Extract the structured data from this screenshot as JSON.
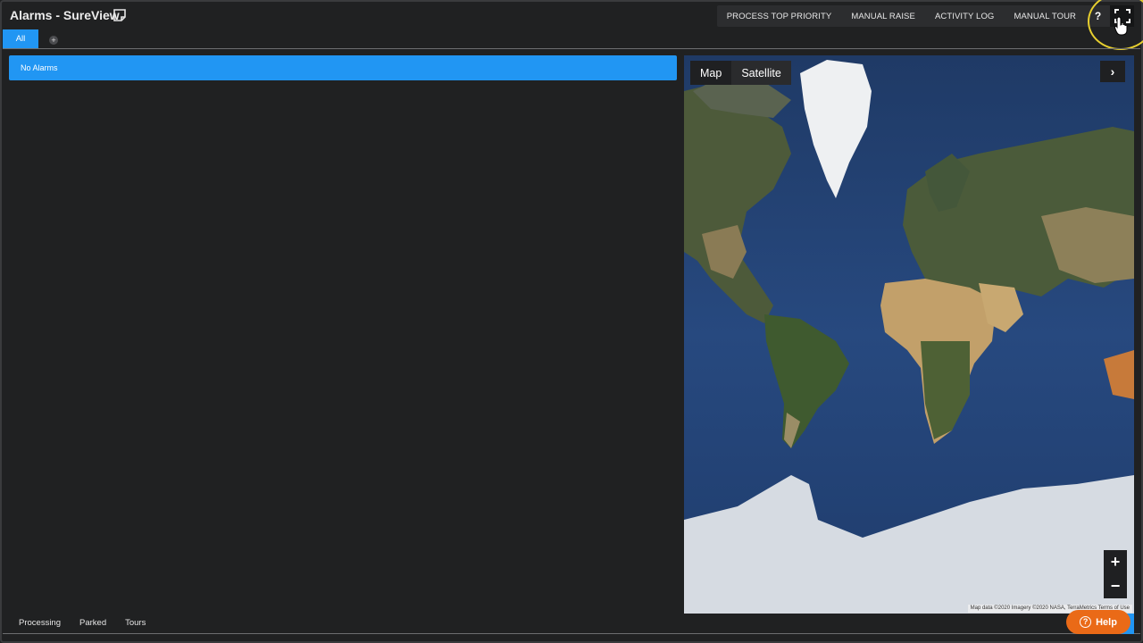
{
  "app": {
    "title": "Alarms - SureView"
  },
  "toolbar": {
    "buttons": [
      "PROCESS TOP PRIORITY",
      "MANUAL RAISE",
      "ACTIVITY LOG",
      "MANUAL TOUR"
    ],
    "help_glyph": "?",
    "fullscreen_icon": "fullscreen-icon"
  },
  "tabs": {
    "all_label": "All",
    "add_glyph": "+"
  },
  "alarms": {
    "empty_text": "No Alarms"
  },
  "map": {
    "type_buttons": [
      "Map",
      "Satellite"
    ],
    "expand_glyph": "›",
    "zoom_in": "+",
    "zoom_out": "−",
    "attribution": "Map data ©2020 Imagery ©2020 NASA, TerraMetrics  Terms of Use"
  },
  "bottom_tabs": [
    "Processing",
    "Parked",
    "Tours"
  ],
  "help_button": {
    "label": "Help",
    "glyph": "?"
  },
  "colors": {
    "accent": "#2196f3",
    "help": "#ea6a17",
    "background": "#202122",
    "highlight": "#e7cf2f"
  }
}
